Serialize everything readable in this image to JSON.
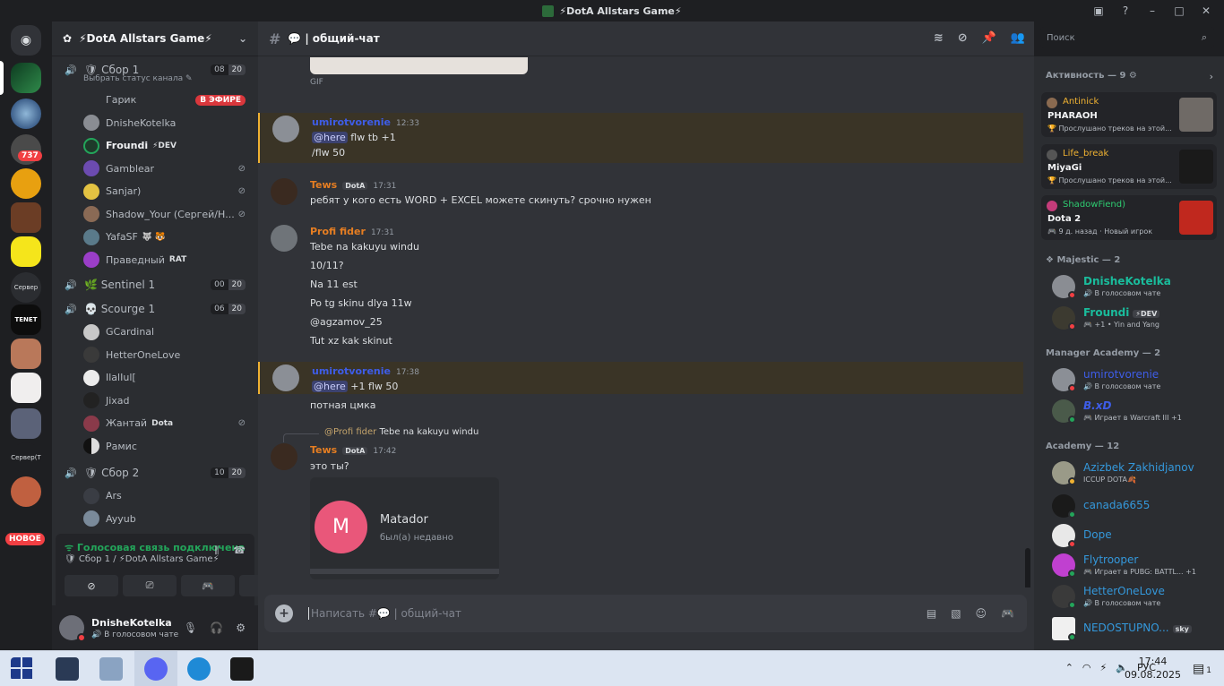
{
  "window": {
    "title": "⚡DotA Allstars Game⚡"
  },
  "servers": {
    "badge_737": "737",
    "new_badge": "НОВОЕ",
    "label_server": "Сервер",
    "label_server2": "Сервер(Т",
    "label_tenet": "TENET"
  },
  "guild": {
    "name": "⚡DotA Allstars Game⚡"
  },
  "voice_channels": [
    {
      "name": "Сбор 1",
      "status": "Выбрать статус канала",
      "count_a": "08",
      "count_b": "20"
    },
    {
      "name": "Sentinel 1",
      "count_a": "00",
      "count_b": "20"
    },
    {
      "name": "Scourge 1",
      "count_a": "06",
      "count_b": "20"
    },
    {
      "name": "Сбор 2",
      "count_a": "10",
      "count_b": "20"
    }
  ],
  "voice_users_1": [
    {
      "name": "Гарик",
      "live": "В ЭФИРЕ"
    },
    {
      "name": "DnisheKotelka"
    },
    {
      "name": "Froundi",
      "tag": "⚡DEV"
    },
    {
      "name": "Gamblear"
    },
    {
      "name": "Sanjar)"
    },
    {
      "name": "Shadow_Your (Сергей/Н..."
    },
    {
      "name": "YafaSF",
      "tag": "🐺 🐯"
    },
    {
      "name": "Праведный",
      "tag": "RAT"
    }
  ],
  "voice_users_scourge": [
    {
      "name": "GCardinal"
    },
    {
      "name": "HetterOneLove"
    },
    {
      "name": "IlalIul["
    },
    {
      "name": "Jixad"
    },
    {
      "name": "Жантай",
      "tag": "Dota"
    },
    {
      "name": "Рамис"
    }
  ],
  "voice_users_2": [
    {
      "name": "Ars"
    },
    {
      "name": "Ayyub"
    }
  ],
  "voice_panel": {
    "status": "Голосовая связь подключена",
    "sub": "Сбор 1 / ⚡DotA Allstars Game⚡"
  },
  "user": {
    "name": "DnisheKotelka",
    "status": "В голосовом чате"
  },
  "channel": {
    "name": "общий-чат"
  },
  "search": {
    "placeholder": "Поиск"
  },
  "messages": {
    "gif_label": "GIF",
    "m1": {
      "author": "umirotvorenie",
      "time": "12:33",
      "mention": "@here",
      "l1": " flw tb +1",
      "l2": "/flw 50"
    },
    "m2": {
      "author": "Tews",
      "tag": "DotA",
      "time": "17:31",
      "l1": "ребят у кого есть WORD + EXCEL можете скинуть? срочно нужен"
    },
    "m3": {
      "author": "Profi fider",
      "time": "17:31",
      "lines": [
        "Tebe na kakuyu windu",
        "10/11?",
        "Na 11 est",
        "Po tg skinu dlya 11w",
        "@agzamov_25",
        "Tut xz kak skinut"
      ]
    },
    "m4": {
      "author": "umirotvorenie",
      "time": "17:38",
      "mention": "@here",
      "l1": " +1 flw 50",
      "l2": "потная цмка"
    },
    "reply": {
      "author": "@Profi fider",
      "text": "Tebe na kakuyu windu"
    },
    "m5": {
      "author": "Tews",
      "tag": "DotA",
      "time": "17:42",
      "l1": "это ты?"
    },
    "card": {
      "initial": "M",
      "title": "Matador",
      "sub": "был(а) недавно"
    }
  },
  "composer": {
    "placeholder": "Написать #💬 | общий-чат"
  },
  "activity": {
    "header": "Активность — 9",
    "items": [
      {
        "user": "Antinick",
        "title": "PHARAOH",
        "sub": "Прослушано треков на этой..."
      },
      {
        "user": "Life_break",
        "title": "MiyaGi",
        "sub": "Прослушано треков на этой..."
      },
      {
        "user": "ShadowFiend)",
        "title": "Dota 2",
        "sub": "9 д. назад  ·  Новый игрок"
      }
    ]
  },
  "member_groups": {
    "majestic": "Majestic — 2",
    "manager": "Manager Academy — 2",
    "academy": "Academy — 12"
  },
  "members": [
    {
      "name": "DnisheKotelka",
      "sub": "В голосовом чате",
      "color": "#1abc9c"
    },
    {
      "name": "Froundi",
      "tag": "⚡DEV",
      "sub": "+1 • Yin and Yang",
      "color": "#1abc9c"
    },
    {
      "name": "umirotvorenie",
      "sub": "В голосовом чате",
      "color": "#3e5de8"
    },
    {
      "name": "B.xD",
      "sub": "Играет в Warcraft III +1",
      "color": "#3e5de8"
    },
    {
      "name": "Azizbek Zakhidjanov",
      "sub": "ICCUP DOTA🍂",
      "color": "#3498db"
    },
    {
      "name": "canada6655",
      "sub": "",
      "color": "#3498db"
    },
    {
      "name": "Dope",
      "sub": "",
      "color": "#3498db"
    },
    {
      "name": "Flytrooper",
      "sub": "Играет в PUBG: BATTL... +1",
      "color": "#3498db"
    },
    {
      "name": "HetterOneLove",
      "sub": "В голосовом чате",
      "color": "#3498db"
    },
    {
      "name": "NEDOSTUPNO...",
      "tag": "sky",
      "sub": "",
      "color": "#3498db"
    }
  ],
  "taskbar": {
    "lang": "РУС",
    "time": "17:44",
    "date": "09.08.2025",
    "notif_count": "1"
  }
}
